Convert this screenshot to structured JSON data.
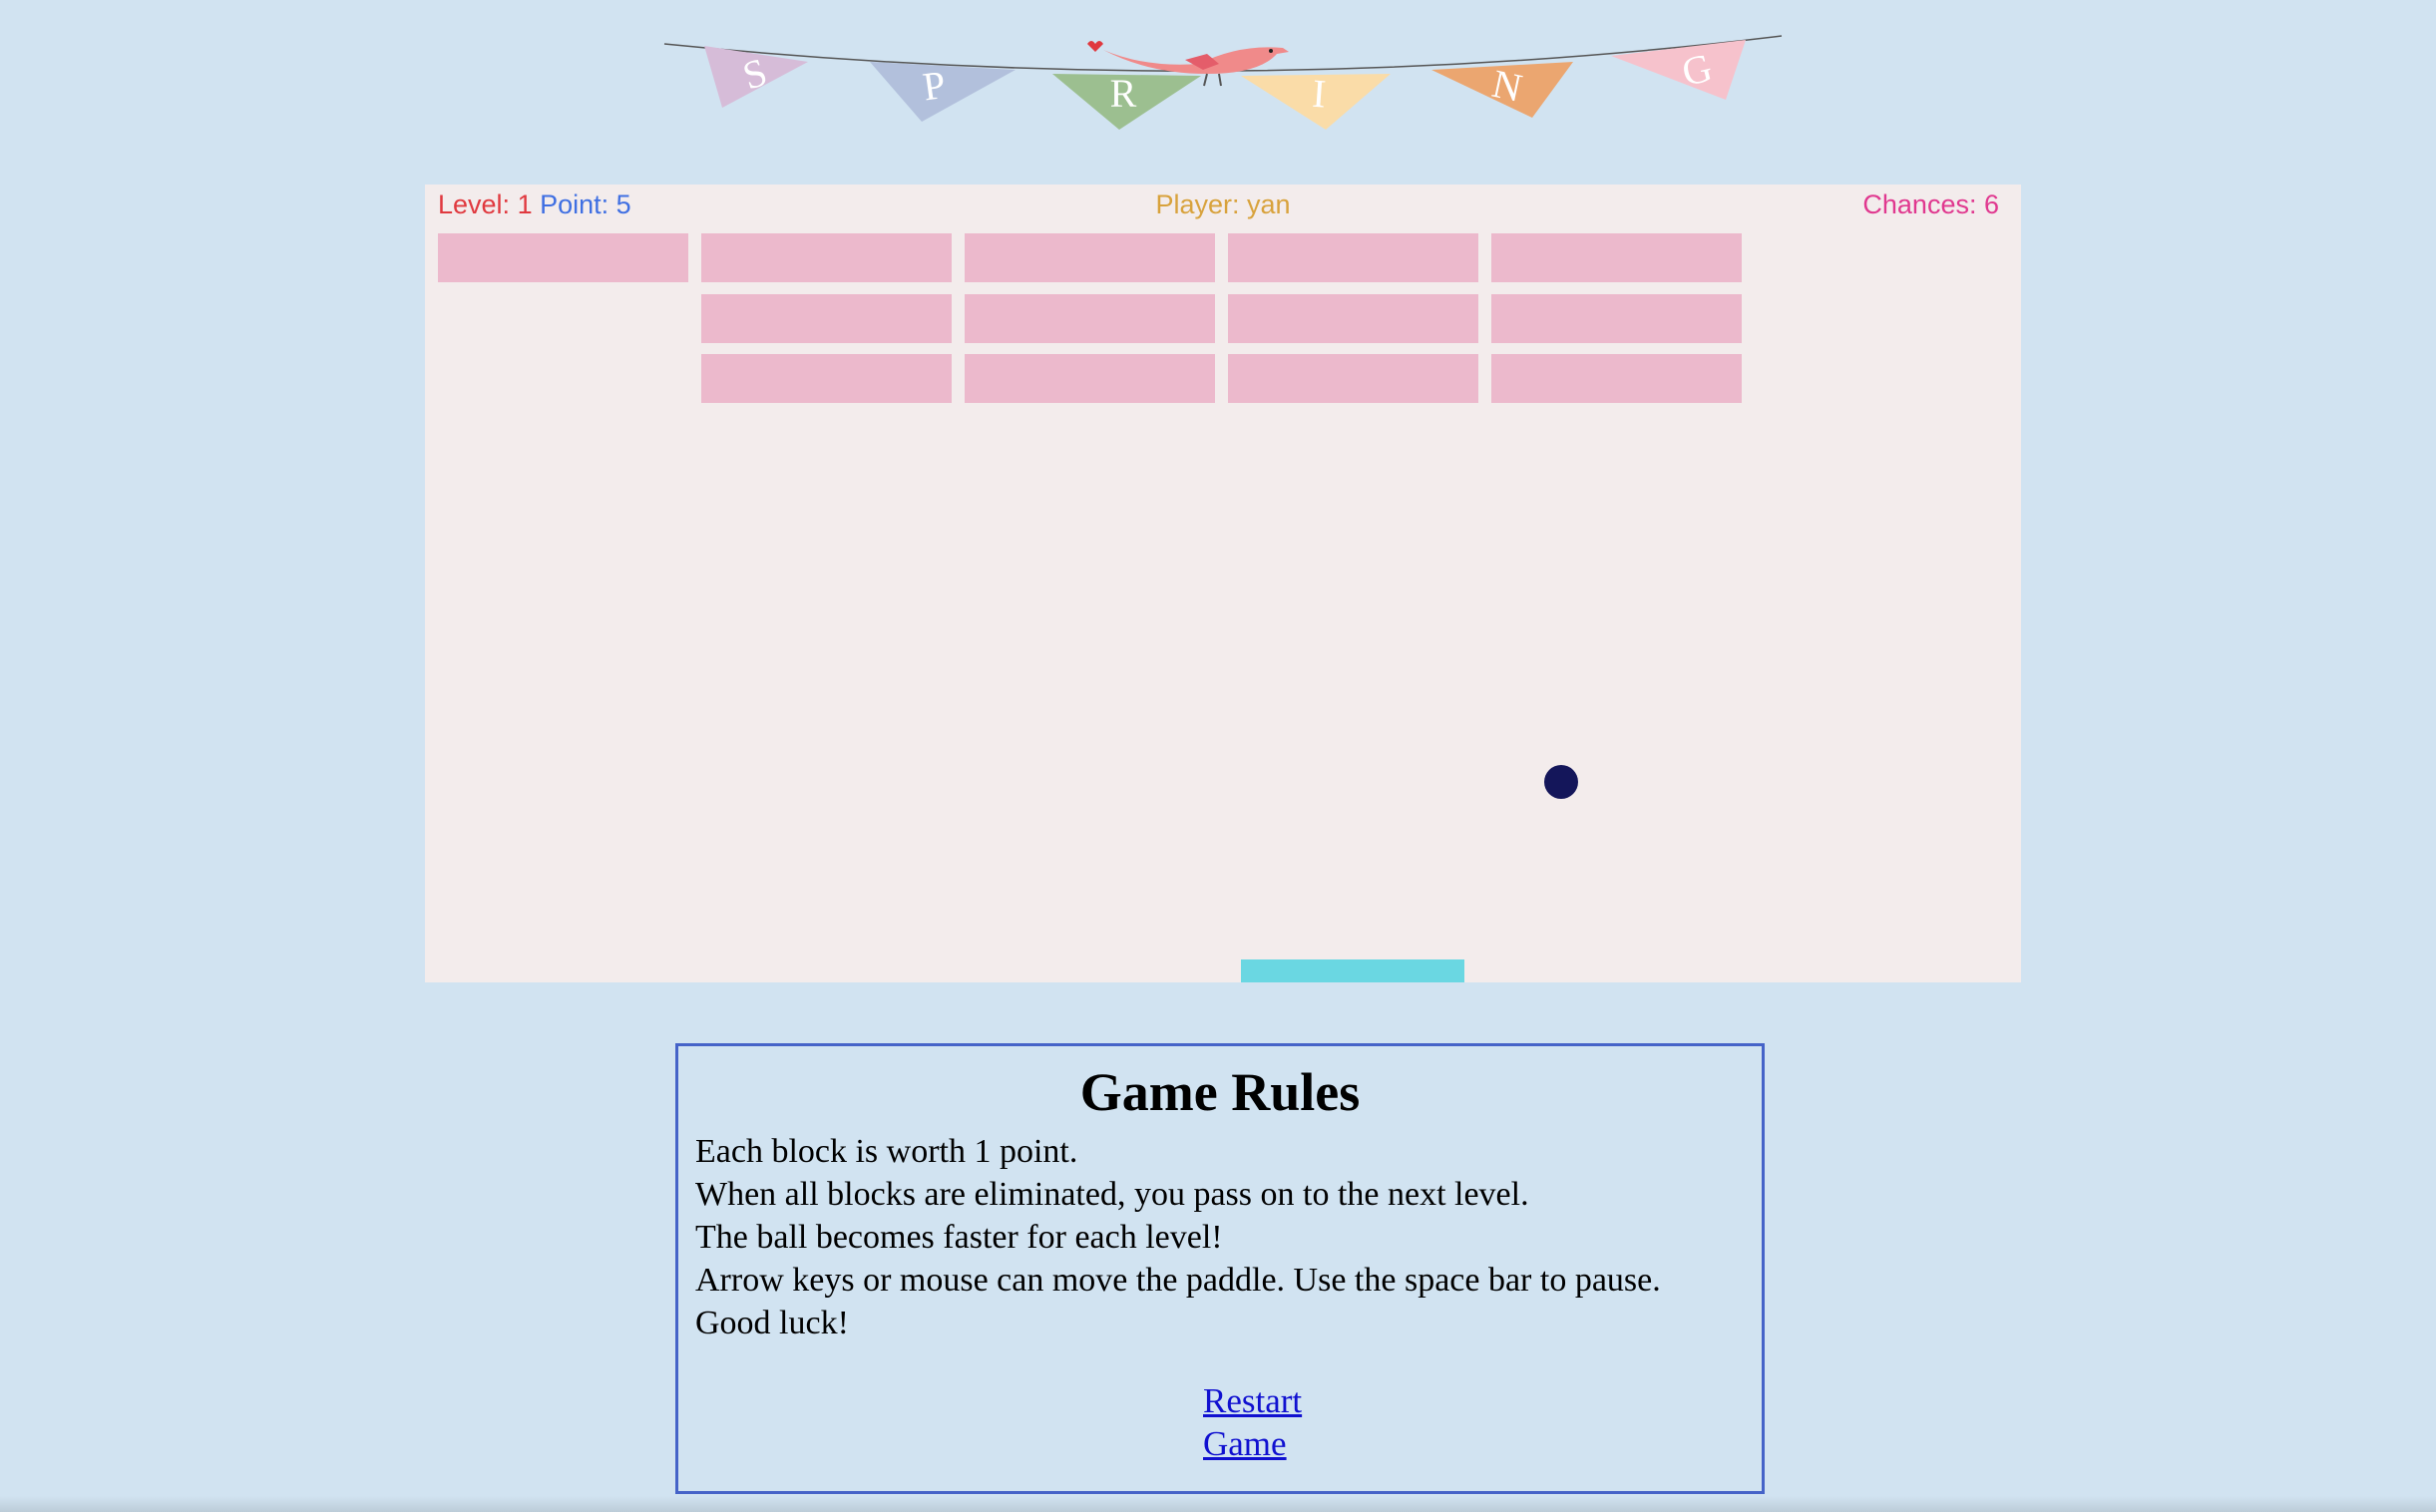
{
  "banner": {
    "letters": [
      {
        "char": "S",
        "color": "#d6bcd8"
      },
      {
        "char": "P",
        "color": "#b2c0dc"
      },
      {
        "char": "R",
        "color": "#9cbf90"
      },
      {
        "char": "I",
        "color": "#fadca8"
      },
      {
        "char": "N",
        "color": "#eba670"
      },
      {
        "char": "G",
        "color": "#f6c2cc"
      }
    ],
    "bird_color": "#f08a8a"
  },
  "hud": {
    "level_label": "Level: ",
    "level": "1",
    "point_label": "Point: ",
    "points": "5",
    "player_label": "Player: ",
    "player": "yan",
    "chances_label": "Chances: ",
    "chances": "6"
  },
  "board": {
    "background": "#f3ecec",
    "brick_color": "#ecb9cc",
    "bricks": [
      {
        "row": 0,
        "col": 0
      },
      {
        "row": 0,
        "col": 1
      },
      {
        "row": 0,
        "col": 2
      },
      {
        "row": 0,
        "col": 3
      },
      {
        "row": 0,
        "col": 4
      },
      {
        "row": 1,
        "col": 1
      },
      {
        "row": 1,
        "col": 2
      },
      {
        "row": 1,
        "col": 3
      },
      {
        "row": 1,
        "col": 4
      },
      {
        "row": 2,
        "col": 1
      },
      {
        "row": 2,
        "col": 2
      },
      {
        "row": 2,
        "col": 3
      },
      {
        "row": 2,
        "col": 4
      }
    ],
    "ball_color": "#14165a",
    "paddle_color": "#6ad7e2"
  },
  "rules": {
    "title": "Game Rules",
    "lines": [
      "Each block is worth 1 point.",
      "When all blocks are eliminated, you pass on to the next level.",
      "The ball becomes faster for each level!",
      "Arrow keys or mouse can move the paddle. Use the space bar to pause.",
      "Good luck!"
    ],
    "restart_label": "Restart Game"
  }
}
